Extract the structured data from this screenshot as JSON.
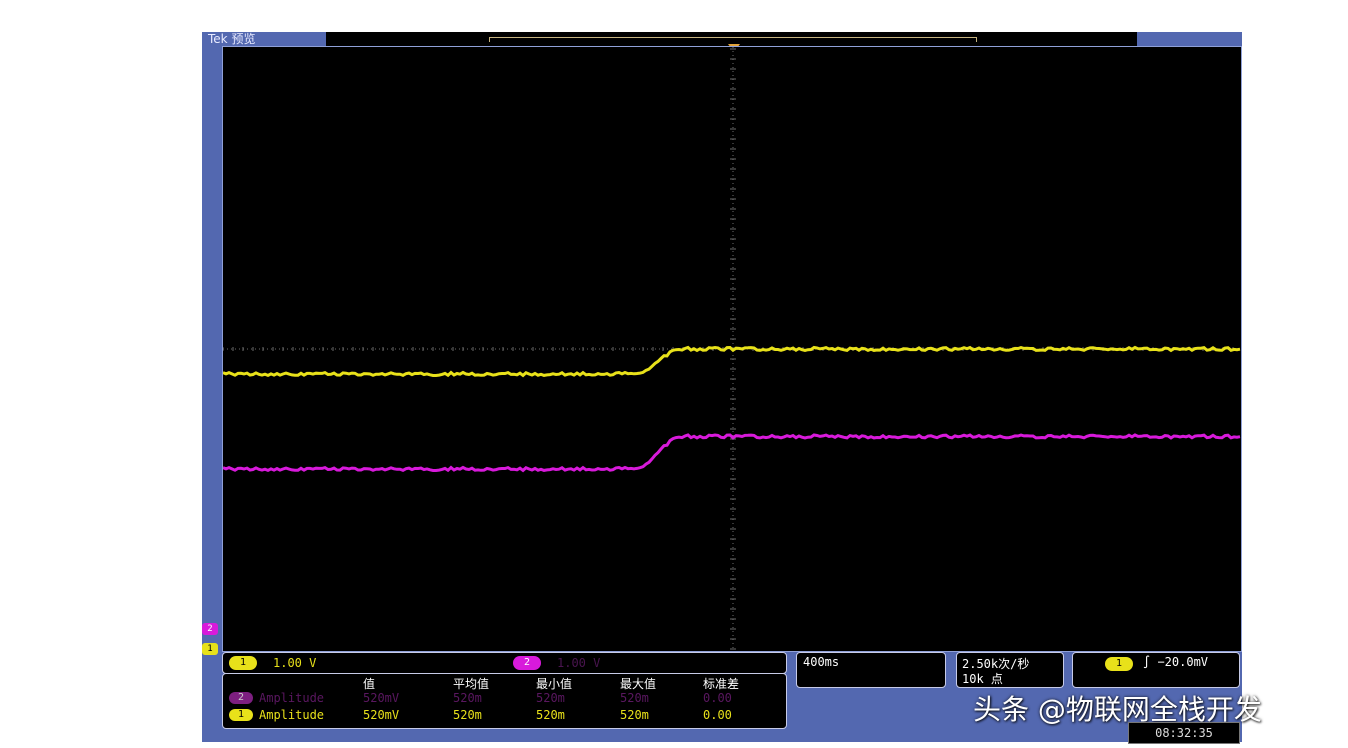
{
  "header": {
    "mode_label": "Tek 预览",
    "colors": {
      "frame": "#5368b0",
      "screen": "#000000"
    }
  },
  "waveforms": {
    "ch1": {
      "color": "#e8e11a",
      "shape": "step-up",
      "low_level_div": -0.5,
      "high_level_div": 0.0
    },
    "ch2": {
      "color": "#d81adb",
      "shape": "step-up",
      "low_level_div": -2.4,
      "high_level_div": -1.75
    }
  },
  "status": {
    "ch1_chip": "1",
    "ch1_scale": "1.00 V",
    "ch2_chip": "2",
    "ch2_scale": "1.00 V"
  },
  "measurements": {
    "headers": [
      "值",
      "平均值",
      "最小值",
      "最大值",
      "标准差"
    ],
    "rows": [
      {
        "chip": "2",
        "label": "Amplitude",
        "values": [
          "520mV",
          "520m",
          "520m",
          "520m",
          "0.00"
        ],
        "color": "#7d1f80"
      },
      {
        "chip": "1",
        "label": "Amplitude",
        "values": [
          "520mV",
          "520m",
          "520m",
          "520m",
          "0.00"
        ],
        "color": "#e8e11a"
      }
    ]
  },
  "timebase": {
    "value": "400ms"
  },
  "sampling": {
    "rate": "2.50k次/秒",
    "points": "10k 点"
  },
  "trigger": {
    "chip": "1",
    "level": "∫ −20.0mV"
  },
  "side_markers": {
    "ch2": "2",
    "ch1": "1"
  },
  "watermark": "头条 @物联网全栈开发",
  "clock": "08:32:35"
}
